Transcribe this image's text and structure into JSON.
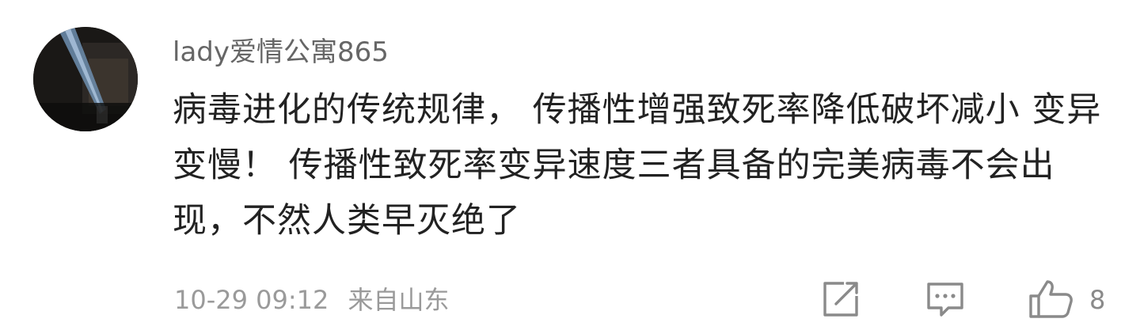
{
  "comment": {
    "username": "lady爱情公寓865",
    "text": "病毒进化的传统规律，  传播性增强致死率降低破坏减小  变异变慢！  传播性致死率变异速度三者具备的完美病毒不会出现，不然人类早灭绝了",
    "timestamp": "10-29 09:12",
    "location": "来自山东",
    "like_count": "8"
  },
  "icons": {
    "share": "share-icon",
    "comment": "comment-icon",
    "like": "thumbs-up-icon"
  },
  "colors": {
    "text": "#222222",
    "username": "#666666",
    "meta": "#9a9a9a",
    "icon": "#8a8a8a"
  }
}
